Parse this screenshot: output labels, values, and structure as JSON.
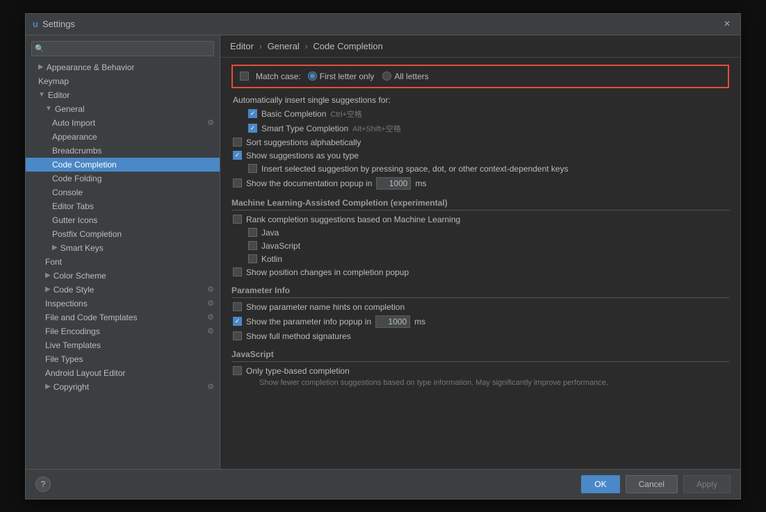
{
  "dialog": {
    "title": "Settings",
    "close_label": "×"
  },
  "breadcrumb": {
    "parts": [
      "Editor",
      "General",
      "Code Completion"
    ]
  },
  "search": {
    "placeholder": "🔍"
  },
  "sidebar": {
    "items": [
      {
        "id": "appearance-behavior",
        "label": "Appearance & Behavior",
        "indent": "indent-1",
        "arrow": "▶",
        "active": false
      },
      {
        "id": "keymap",
        "label": "Keymap",
        "indent": "indent-1",
        "active": false
      },
      {
        "id": "editor",
        "label": "Editor",
        "indent": "indent-1",
        "arrow": "▼",
        "active": false
      },
      {
        "id": "general",
        "label": "General",
        "indent": "indent-2",
        "arrow": "▼",
        "active": false
      },
      {
        "id": "auto-import",
        "label": "Auto Import",
        "indent": "indent-3",
        "icon_right": "⚙",
        "active": false
      },
      {
        "id": "appearance",
        "label": "Appearance",
        "indent": "indent-3",
        "active": false
      },
      {
        "id": "breadcrumbs",
        "label": "Breadcrumbs",
        "indent": "indent-3",
        "active": false
      },
      {
        "id": "code-completion",
        "label": "Code Completion",
        "indent": "indent-3",
        "active": true
      },
      {
        "id": "code-folding",
        "label": "Code Folding",
        "indent": "indent-3",
        "active": false
      },
      {
        "id": "console",
        "label": "Console",
        "indent": "indent-3",
        "active": false
      },
      {
        "id": "editor-tabs",
        "label": "Editor Tabs",
        "indent": "indent-3",
        "active": false
      },
      {
        "id": "gutter-icons",
        "label": "Gutter Icons",
        "indent": "indent-3",
        "active": false
      },
      {
        "id": "postfix-completion",
        "label": "Postfix Completion",
        "indent": "indent-3",
        "active": false
      },
      {
        "id": "smart-keys",
        "label": "Smart Keys",
        "indent": "indent-3",
        "arrow": "▶",
        "active": false
      },
      {
        "id": "font",
        "label": "Font",
        "indent": "indent-2",
        "active": false
      },
      {
        "id": "color-scheme",
        "label": "Color Scheme",
        "indent": "indent-2",
        "arrow": "▶",
        "active": false
      },
      {
        "id": "code-style",
        "label": "Code Style",
        "indent": "indent-2",
        "arrow": "▶",
        "icon_right": "⚙",
        "active": false
      },
      {
        "id": "inspections",
        "label": "Inspections",
        "indent": "indent-2",
        "icon_right": "⚙",
        "active": false
      },
      {
        "id": "file-code-templates",
        "label": "File and Code Templates",
        "indent": "indent-2",
        "icon_right": "⚙",
        "active": false
      },
      {
        "id": "file-encodings",
        "label": "File Encodings",
        "indent": "indent-2",
        "icon_right": "⚙",
        "active": false
      },
      {
        "id": "live-templates",
        "label": "Live Templates",
        "indent": "indent-2",
        "active": false
      },
      {
        "id": "file-types",
        "label": "File Types",
        "indent": "indent-2",
        "active": false
      },
      {
        "id": "android-layout-editor",
        "label": "Android Layout Editor",
        "indent": "indent-2",
        "active": false
      },
      {
        "id": "copyright",
        "label": "Copyright",
        "indent": "indent-2",
        "arrow": "▶",
        "icon_right": "⚙",
        "active": false
      }
    ]
  },
  "content": {
    "match_case_label": "Match case:",
    "radio_first_letter": "First letter only",
    "radio_all_letters": "All letters",
    "auto_insert_label": "Automatically insert single suggestions for:",
    "basic_completion_label": "Basic Completion",
    "basic_completion_shortcut": "Ctrl+空格",
    "smart_type_label": "Smart Type Completion",
    "smart_type_shortcut": "Alt+Shift+空格",
    "sort_alpha_label": "Sort suggestions alphabetically",
    "show_as_type_label": "Show suggestions as you type",
    "insert_space_label": "Insert selected suggestion by pressing space, dot, or other context-dependent keys",
    "show_doc_popup_label": "Show the documentation popup in",
    "show_doc_popup_value": "1000",
    "show_doc_popup_unit": "ms",
    "ml_section": "Machine Learning-Assisted Completion (experimental)",
    "rank_ml_label": "Rank completion suggestions based on Machine Learning",
    "java_label": "Java",
    "javascript_label": "JavaScript",
    "kotlin_label": "Kotlin",
    "show_position_label": "Show position changes in completion popup",
    "param_info_section": "Parameter Info",
    "show_param_hints_label": "Show parameter name hints on completion",
    "show_param_popup_label": "Show the parameter info popup in",
    "show_param_popup_value": "1000",
    "show_param_popup_unit": "ms",
    "show_full_method_label": "Show full method signatures",
    "javascript_section": "JavaScript",
    "only_type_based_label": "Only type-based completion",
    "only_type_based_sub": "Show fewer completion suggestions based on type information. May significantly improve performance."
  },
  "footer": {
    "ok_label": "OK",
    "cancel_label": "Cancel",
    "apply_label": "Apply",
    "help_label": "?"
  }
}
